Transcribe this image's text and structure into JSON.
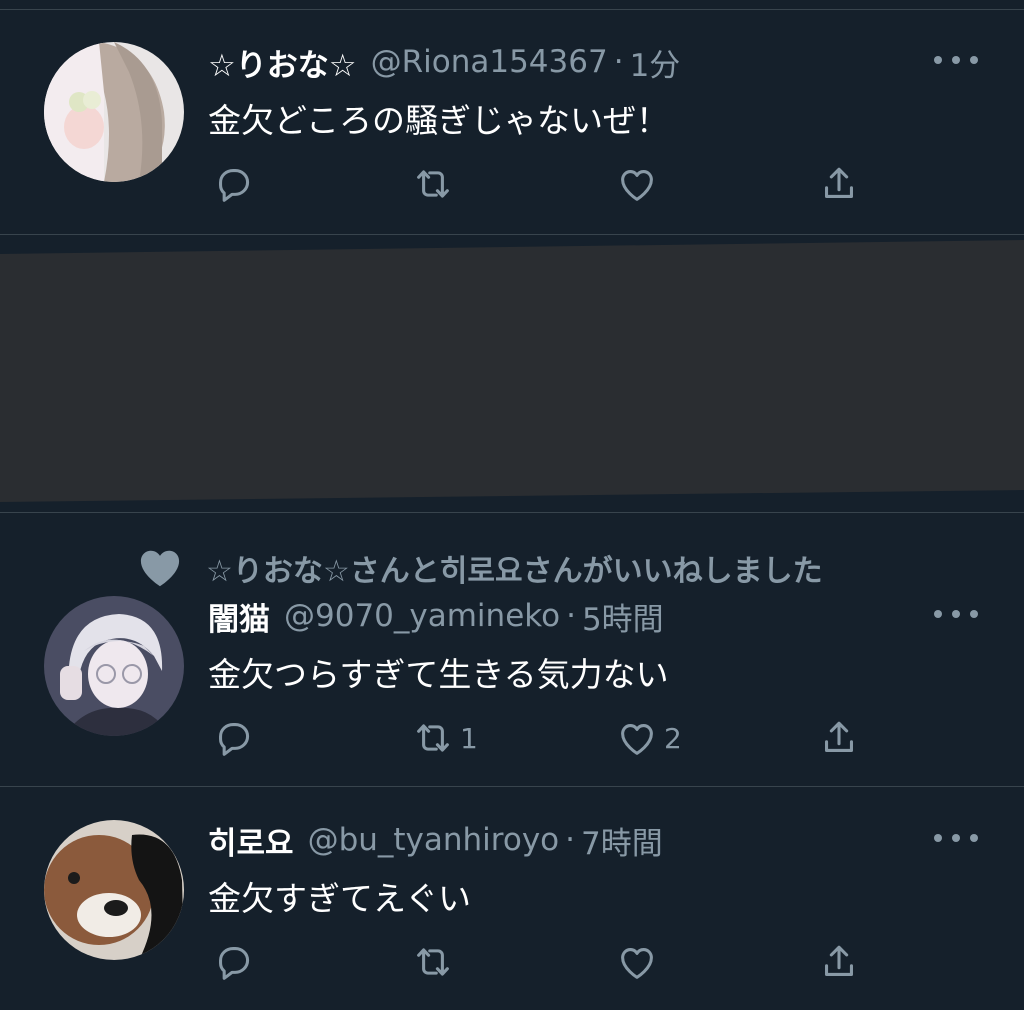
{
  "tweets": [
    {
      "display_name": "☆りおな☆",
      "handle": "@Riona154367",
      "separator": "·",
      "time": "1分",
      "text": "金欠どころの騒ぎじゃないぜ！",
      "reply_count": "",
      "retweet_count": "",
      "like_count": ""
    },
    {
      "liked_by": "☆りおな☆さんと히로요さんがいいねしました",
      "display_name": "闇猫",
      "handle": "@9070_yamineko",
      "separator": "·",
      "time": "5時間",
      "text": "金欠つらすぎて生きる気力ない",
      "reply_count": "",
      "retweet_count": "1",
      "like_count": "2"
    },
    {
      "display_name": "히로요",
      "handle": "@bu_tyanhiroyo",
      "separator": "·",
      "time": "7時間",
      "text": "金欠すぎてえぐい",
      "reply_count": "",
      "retweet_count": "",
      "like_count": ""
    }
  ],
  "icons": {
    "reply": "reply-icon",
    "retweet": "retweet-icon",
    "like": "heart-icon",
    "share": "share-icon",
    "more": "more-icon"
  },
  "colors": {
    "background": "#15202b",
    "secondary_text": "#8899a6",
    "divider": "#38444d",
    "media_placeholder": "#2a2d31"
  }
}
